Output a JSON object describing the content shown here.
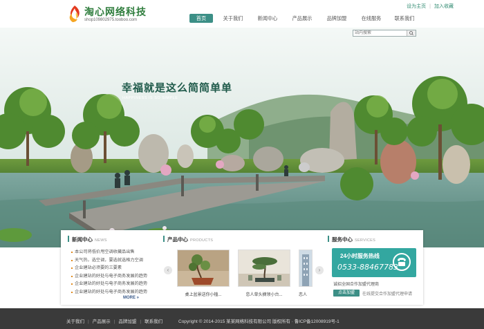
{
  "header": {
    "logo_title": "淘心网络科技",
    "logo_subtitle": "shop109802975.tooboo.com",
    "top_links": {
      "home": "设为主页",
      "favorite": "加入收藏"
    },
    "nav": [
      {
        "label": "首页",
        "active": true
      },
      {
        "label": "关于我们",
        "active": false
      },
      {
        "label": "新闻中心",
        "active": false
      },
      {
        "label": "产品展示",
        "active": false
      },
      {
        "label": "品牌加盟",
        "active": false
      },
      {
        "label": "在线服务",
        "active": false
      },
      {
        "label": "联系我们",
        "active": false
      }
    ]
  },
  "banner": {
    "search_placeholder": "站内搜索",
    "slogan": "幸福就是这么简简单单",
    "slogan_en": "HAPPINESS IS SO SIMPLE"
  },
  "news": {
    "title": "新闻中心",
    "title_en": "NEWS",
    "items": [
      "本公司将低价甩空调收藏品出售",
      "天气热，选空调，要选就选格力空调",
      "企业建站必须要的三要素",
      "企业建站的好处与电子商务发展的趋势",
      "企业建站的好处与电子商务发展的趋势",
      "企业建站的好处与电子商务发展的趋势"
    ],
    "more": "MORE"
  },
  "products": {
    "title": "产品中心",
    "title_en": "PRODUCTS",
    "prev": "‹",
    "next": "›",
    "items": [
      {
        "caption": "桌上盆景送你小植..."
      },
      {
        "caption": "恋人草头摘领小台..."
      },
      {
        "caption": "恋人"
      }
    ]
  },
  "service": {
    "title": "服务中心",
    "title_en": "SERVICES",
    "hotline_label": "24小时服务热线",
    "hotline_number": "0533-88467783",
    "recruit_text": "诚招全国合作加盟代理商",
    "join_button": "点击加盟",
    "join_note": "在线提交合作加盟代理申请"
  },
  "footer": {
    "links": [
      "关于我们",
      "产品展示",
      "品牌加盟",
      "联系我们"
    ],
    "copyright": "Copyright © 2014-2015 某某网络科技有限公司 版权所有 · 鲁ICP备12008919号-1"
  },
  "colors": {
    "accent": "#3c8f86",
    "hotline_bg": "#33a7a0",
    "footer_bg": "#3a3a3a",
    "logo_green": "#2f7d3d"
  }
}
